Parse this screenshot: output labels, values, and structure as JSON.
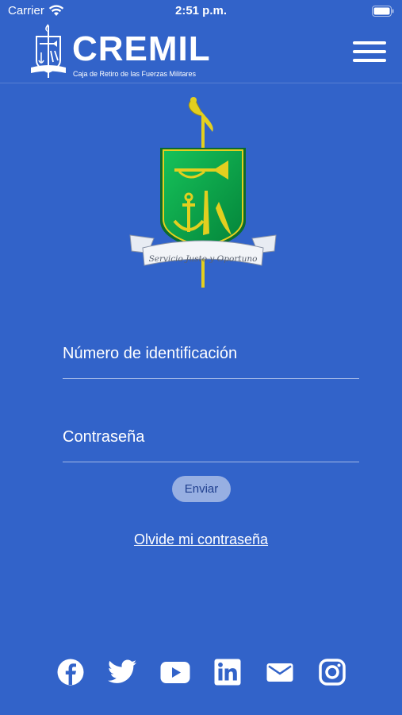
{
  "status_bar": {
    "carrier": "Carrier",
    "time": "2:51 p.m."
  },
  "header": {
    "brand_name": "CREMIL",
    "tagline": "Caja de Retiro de las Fuerzas Militares",
    "menu_icon": "hamburger-menu-icon"
  },
  "crest": {
    "motto": "Servicio Justo y Oportuno"
  },
  "login_form": {
    "id_placeholder": "Número de identificación",
    "id_value": "",
    "password_placeholder": "Contraseña",
    "password_value": "",
    "submit_label": "Enviar",
    "forgot_label": "Olvide mi contraseña"
  },
  "social": [
    "facebook-icon",
    "twitter-icon",
    "youtube-icon",
    "linkedin-icon",
    "email-icon",
    "instagram-icon"
  ],
  "colors": {
    "background": "#3263c9",
    "button_bg": "#97afe2",
    "button_text": "#1f3f8e",
    "shield_green": "#0aa34a",
    "gold": "#e3cf1f"
  }
}
